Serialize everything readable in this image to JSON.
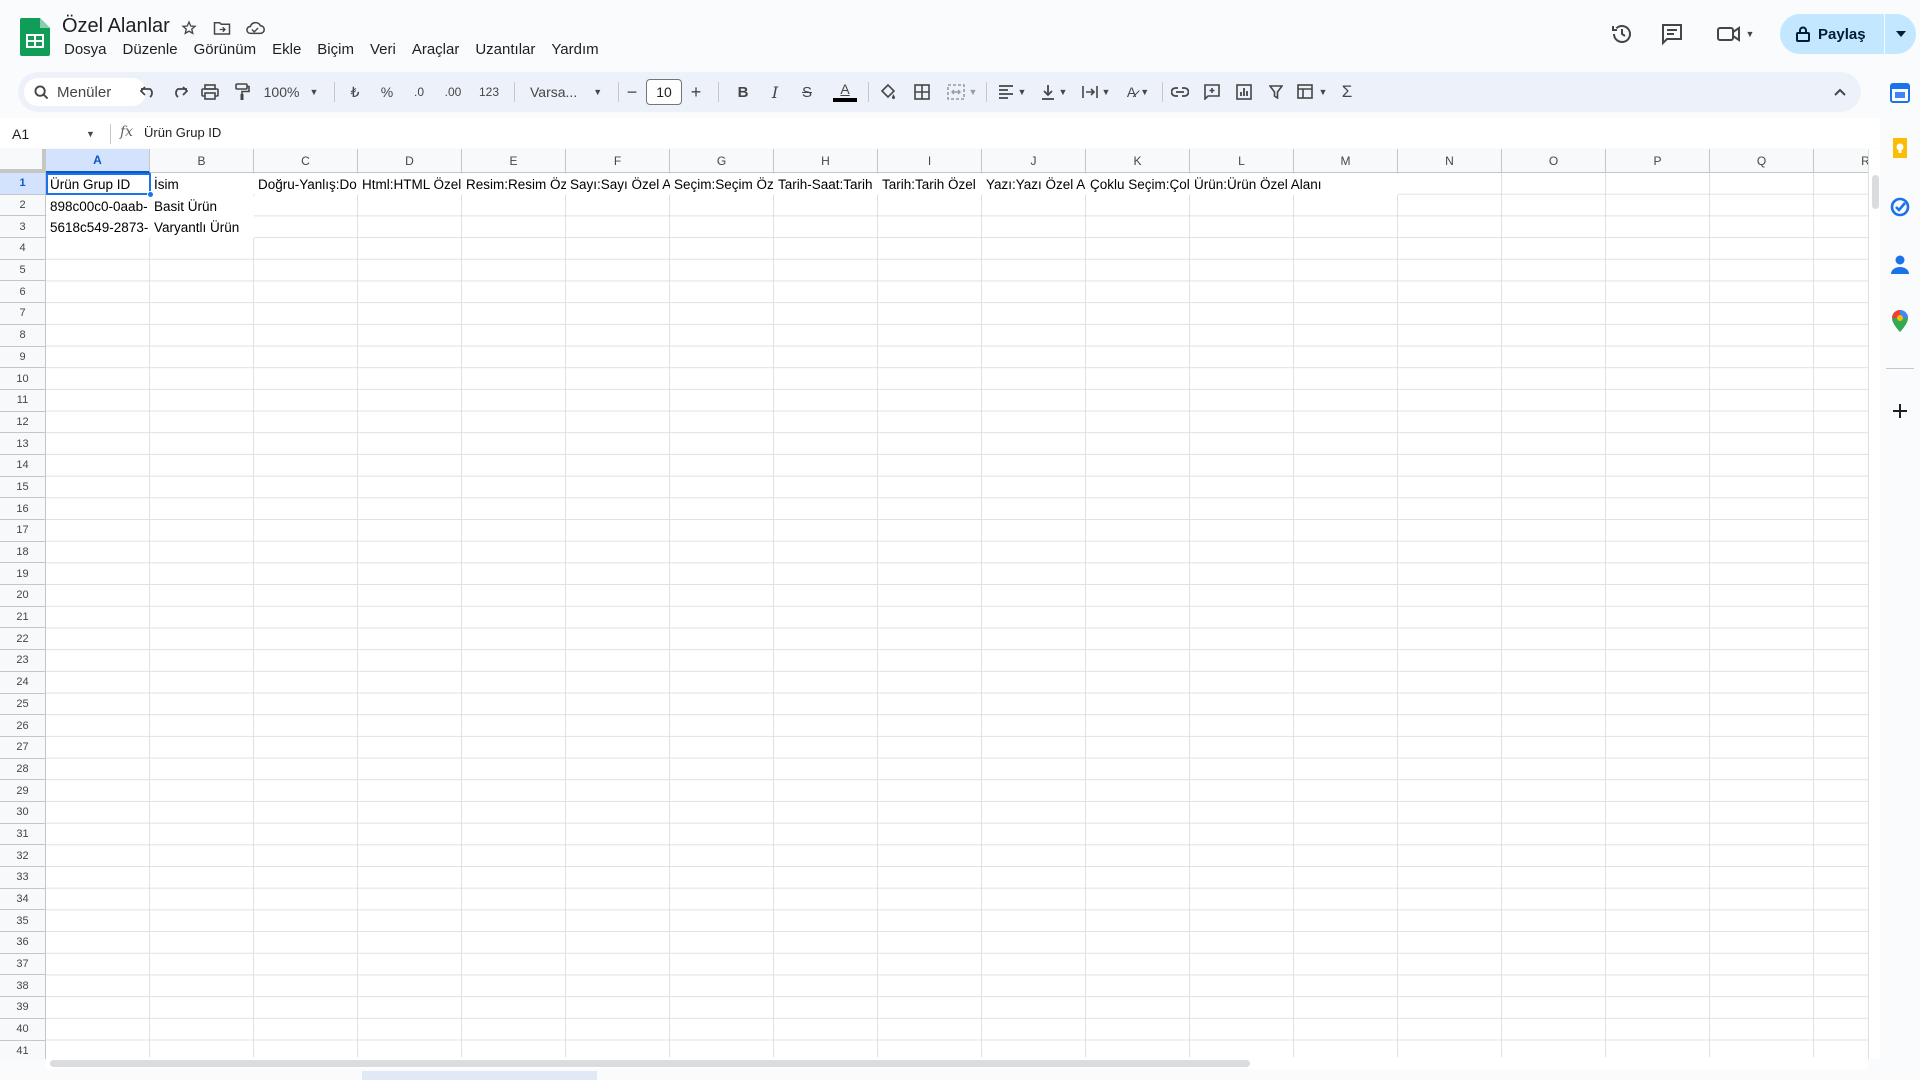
{
  "app": {
    "title": "Özel Alanlar",
    "menu": [
      "Dosya",
      "Düzenle",
      "Görünüm",
      "Ekle",
      "Biçim",
      "Veri",
      "Araçlar",
      "Uzantılar",
      "Yardım"
    ],
    "share_label": "Paylaş",
    "brand_color": "#0f9d58",
    "accent_color": "#0b57d0"
  },
  "toolbar": {
    "menus_label": "Menüler",
    "zoom": "100%",
    "currency": "₺",
    "percent": "%",
    "dec_decrease": ".0",
    "dec_increase": ".00",
    "number_format": "123",
    "font": "Varsa...",
    "font_size": "10",
    "bold": "B",
    "italic": "I",
    "strike": "S",
    "text_color": "A",
    "sum": "Σ"
  },
  "formula_bar": {
    "cell_ref": "A1",
    "fx": "fx",
    "value": "Ürün Grup ID"
  },
  "grid": {
    "columns": [
      "A",
      "B",
      "C",
      "D",
      "E",
      "F",
      "G",
      "H",
      "I",
      "J",
      "K",
      "L",
      "M",
      "N",
      "O",
      "P",
      "Q",
      "R"
    ],
    "row_count": 41,
    "rows": [
      [
        "Ürün Grup ID",
        "İsim",
        "Doğru-Yanlış:Do",
        "Html:HTML Özel",
        "Resim:Resim Öz",
        "Sayı:Sayı Özel A",
        "Seçim:Seçim Öz",
        "Tarih-Saat:Tarih",
        "Tarih:Tarih Özel",
        "Yazı:Yazı Özel A",
        "Çoklu Seçim:Çol",
        "Ürün:Ürün Özel Alanı"
      ],
      [
        "898c00c0-0aab-",
        "Basit Ürün"
      ],
      [
        "5618c549-2873-",
        "Varyantlı Ürün"
      ]
    ]
  },
  "side_panel": {
    "icons": [
      "calendar-icon",
      "keep-icon",
      "tasks-icon",
      "contacts-icon",
      "maps-icon",
      "add-icon"
    ]
  }
}
